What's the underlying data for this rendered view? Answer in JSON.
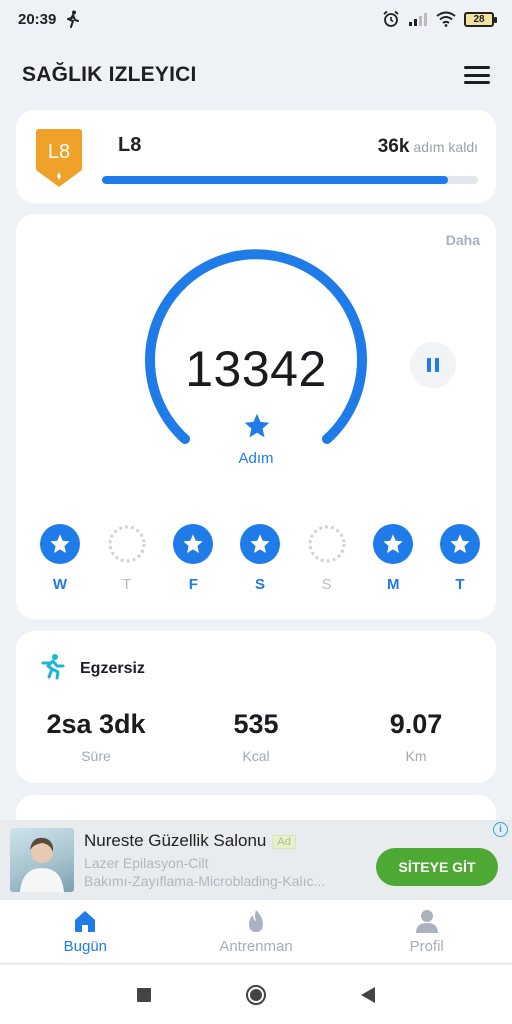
{
  "status_bar": {
    "time": "20:39",
    "battery": "28"
  },
  "header": {
    "title": "SAĞLIK IZLEYICI"
  },
  "level_card": {
    "badge_text": "L8",
    "level_label": "L8",
    "remaining_value": "36k",
    "remaining_label": "adım kaldı",
    "progress_fraction": 0.92
  },
  "steps_card": {
    "more_label": "Daha",
    "step_count": "13342",
    "unit_label": "Adım",
    "week": [
      {
        "label": "W",
        "done": true
      },
      {
        "label": "T",
        "done": false
      },
      {
        "label": "F",
        "done": true
      },
      {
        "label": "S",
        "done": true
      },
      {
        "label": "S",
        "done": false
      },
      {
        "label": "M",
        "done": true
      },
      {
        "label": "T",
        "done": true
      }
    ]
  },
  "exercise_card": {
    "title": "Egzersiz",
    "stats": [
      {
        "value": "2sa 3dk",
        "label": "Süre"
      },
      {
        "value": "535",
        "label": "Kcal"
      },
      {
        "value": "9.07",
        "label": "Km"
      }
    ]
  },
  "ad": {
    "title": "Nureste Güzellik Salonu",
    "tag": "Ad",
    "line1": "Lazer Epilasyon-Cilt",
    "line2": "Bakımı-Zayıflama-Microblading-Kalıc...",
    "cta": "SİTEYE GİT"
  },
  "bottom_nav": {
    "items": [
      {
        "label": "Bugün",
        "active": true
      },
      {
        "label": "Antrenman",
        "active": false
      },
      {
        "label": "Profil",
        "active": false
      }
    ]
  },
  "colors": {
    "accent": "#1f7be8",
    "badge": "#f0a12a",
    "cta": "#4ea934"
  }
}
